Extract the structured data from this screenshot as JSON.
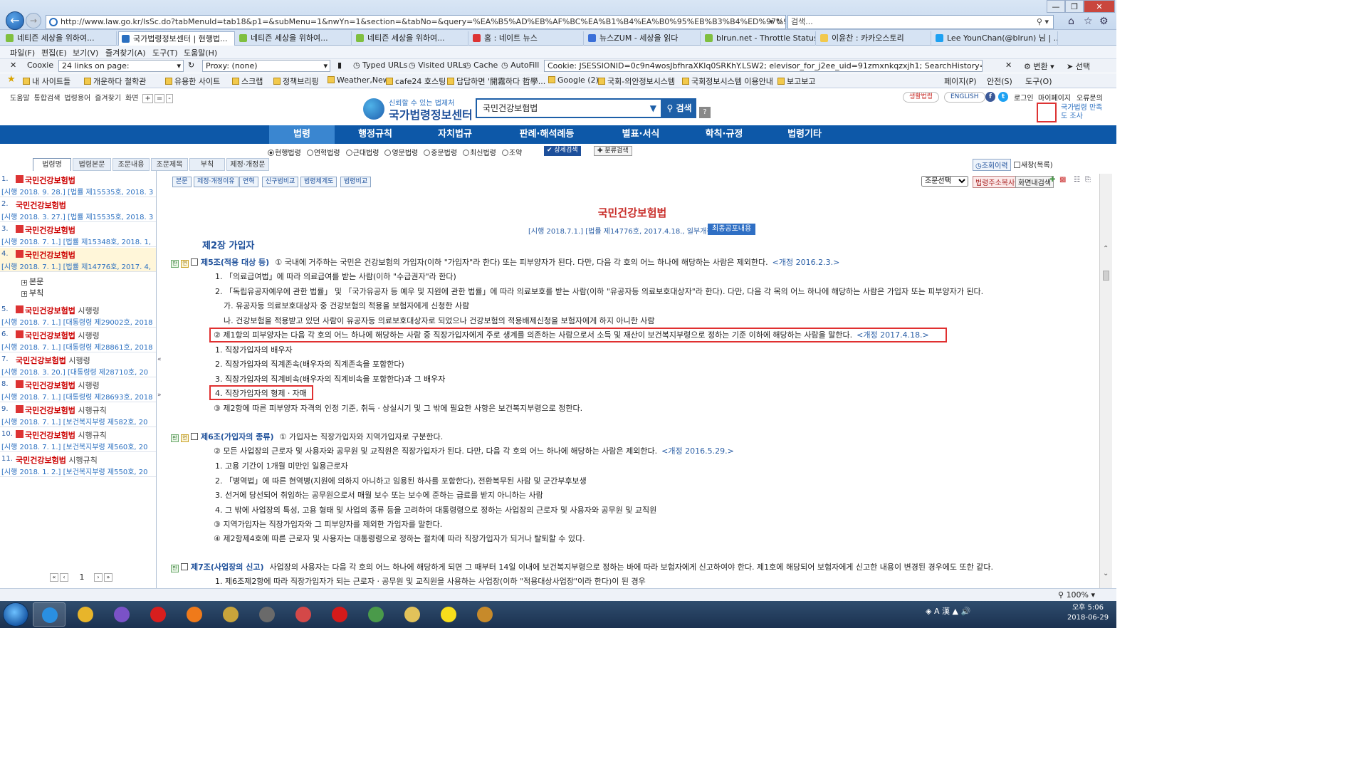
{
  "browser": {
    "url": "http://www.law.go.kr/lsSc.do?tabMenuId=tab18&p1=&subMenu=1&nwYn=1&section=&tabNo=&query=%EA%B5%AD%EB%AF%BC%EA%B1%B4%EA%B0%95%EB%B3%B4%ED%97%98%EB%B2%95#undefined",
    "search_placeholder": "검색...",
    "tabs": [
      {
        "label": "네티즌 세상을 위하여...",
        "color": "#7fbf3f"
      },
      {
        "label": "국가법령정보센터 | 현행법...",
        "color": "#2a6fc0"
      },
      {
        "label": "네티즌 세상을 위하여...",
        "color": "#7fbf3f"
      },
      {
        "label": "네티즌 세상을 위하여...",
        "color": "#7fbf3f"
      },
      {
        "label": "홈 : 네이트 뉴스",
        "color": "#d33"
      },
      {
        "label": "뉴스ZUM - 세상을 읽다",
        "color": "#3a6fd8"
      },
      {
        "label": "blrun.net - Throttle Status",
        "color": "#7fbf3f"
      },
      {
        "label": "이윤찬 : 카카오스토리",
        "color": "#f2c94c"
      },
      {
        "label": "Lee YounChan(@blrun) 님 | ...",
        "color": "#1da1f2"
      }
    ],
    "menu": [
      "파일(F)",
      "편집(E)",
      "보기(V)",
      "즐겨찾기(A)",
      "도구(T)",
      "도움말(H)"
    ],
    "toolbar": {
      "cooxie": "Cooxie",
      "links": "24 links on page:",
      "proxy": "Proxy: (none)",
      "typed_urls": "Typed URLs",
      "visited_urls": "Visited URLs",
      "cache": "Cache",
      "autofill": "AutoFill",
      "cookie": "Cookie: JSESSIONID=0c9n4wosJbfhraXKlq0SRKhY.LSW2; elevisor_for_j2ee_uid=91zmxnkqzxjh1; SearchHistory=%25uAD6D%25uBBFC%2",
      "convert": "변환",
      "select": "선택"
    },
    "favorites": [
      "내 사이트들",
      "개운하다 철학관",
      "유용한 사이트",
      "스크랩",
      "정책브리핑",
      "Weather,News",
      "cafe24 호스팅",
      "답답하면 '開霧하다 哲學...",
      "Google (2)",
      "국회-의안정보시스템",
      "국회정보시스템 이용안내",
      "보고보고"
    ],
    "fav_tools": [
      "페이지(P)",
      "안전(S)",
      "도구(O)"
    ],
    "zoom": "100%"
  },
  "site": {
    "util_links": [
      "도움말",
      "통합검색",
      "법령용어",
      "즐겨찾기",
      "화면",
      "+",
      "=",
      "-"
    ],
    "slogan": "신뢰할 수 있는 법제처",
    "name": "국가법령정보센터",
    "search_value": "국민건강보험법",
    "search_button": "검색",
    "help": "?",
    "pill_life": "생활법령",
    "pill_english": "ENGLISH",
    "right_links": [
      "로그인",
      "마이페이지",
      "오류문의"
    ],
    "survey": "국가법령 만족도 조사",
    "nav": [
      "법령",
      "행정규칙",
      "자치법규",
      "판례·해석례등",
      "별표·서식",
      "학칙·규정",
      "법령기타"
    ],
    "radios": [
      "현행법령",
      "연혁법령",
      "근대법령",
      "영문법령",
      "중문법령",
      "최신법령",
      "조약"
    ],
    "detail_search": "상세검색",
    "category_search": "분류검색",
    "left_tabs": [
      "법령명",
      "법령본문",
      "조문내용",
      "조문제목",
      "부칙",
      "제정·개정문"
    ],
    "history_btn": "조회이력",
    "new_window": "새창(목록)"
  },
  "left_list": [
    {
      "num": "1.",
      "badge": true,
      "name": "국민건강보험법",
      "suffix": "",
      "sub": "[시행 2018. 9. 28.] [법률 제15535호, 2018. 3"
    },
    {
      "num": "2.",
      "badge": false,
      "name": "국민건강보험법",
      "suffix": "",
      "sub": "[시행 2018. 3. 27.] [법률 제15535호, 2018. 3"
    },
    {
      "num": "3.",
      "badge": true,
      "name": "국민건강보험법",
      "suffix": "",
      "sub": "[시행 2018. 7. 1.] [법률 제15348호, 2018. 1,"
    },
    {
      "num": "4.",
      "badge": true,
      "name": "국민건강보험법",
      "suffix": "",
      "sub": "[시행 2018. 7. 1.] [법률 제14776호, 2017. 4,"
    },
    {
      "num": "5.",
      "badge": true,
      "name": "국민건강보험법",
      "suffix": " 시행령",
      "sub": "[시행 2018. 7. 1.] [대통령령 제29002호, 2018"
    },
    {
      "num": "6.",
      "badge": true,
      "name": "국민건강보험법",
      "suffix": " 시행령",
      "sub": "[시행 2018. 7. 1.] [대통령령 제28861호, 2018"
    },
    {
      "num": "7.",
      "badge": false,
      "name": "국민건강보험법",
      "suffix": " 시행령",
      "sub": "[시행 2018. 3. 20.] [대통령령 제28710호, 20"
    },
    {
      "num": "8.",
      "badge": true,
      "name": "국민건강보험법",
      "suffix": " 시행령",
      "sub": "[시행 2018. 7. 1.] [대통령령 제28693호, 2018"
    },
    {
      "num": "9.",
      "badge": true,
      "name": "국민건강보험법",
      "suffix": " 시행규칙",
      "sub": "[시행 2018. 7. 1.] [보건복지부령 제582호, 20"
    },
    {
      "num": "10.",
      "badge": true,
      "name": "국민건강보험법",
      "suffix": " 시행규칙",
      "sub": "[시행 2018. 7. 1.] [보건복지부령 제560호, 20"
    },
    {
      "num": "11.",
      "badge": false,
      "name": "국민건강보험법",
      "suffix": " 시행규칙",
      "sub": "[시행 2018. 1. 2.] [보건복지부령 제550호, 20"
    }
  ],
  "tree": [
    "본문",
    "부칙"
  ],
  "pager_page": "1",
  "content": {
    "buttons": [
      "본문",
      "제정·개정이유",
      "연혁",
      "신구법비교",
      "법령체계도",
      "법령비교"
    ],
    "select": "조문선택",
    "addr_btn": "법령주소복사",
    "screen_search": "화면내검색",
    "title": "국민건강보험법",
    "meta": "[시행 2018.7.1.] [법률 제14776호, 2017.4.18., 일부개정]",
    "meta_btn": "최종공포내용",
    "chapter": "제2장 가입자",
    "lines": [
      {
        "badges": [
          "판",
          "연"
        ],
        "check": true,
        "head": "제5조(적용 대상 등)",
        "text": "① 국내에 거주하는 국민은 건강보험의 가입자(이하 \"가입자\"라 한다) 또는 피부양자가 된다. 다만, 다음 각 호의 어느 하나에 해당하는 사람은 제외한다.",
        "amend": "<개정 2016.2.3.>"
      },
      {
        "text": "1. 「의료급여법」에 따라 의료급여를 받는 사람(이하 \"수급권자\"라 한다)"
      },
      {
        "text": "2. 「독립유공자예우에 관한 법률」 및 「국가유공자 등 예우 및 지원에 관한 법률」에 따라 의료보호를 받는 사람(이하 \"유공자등 의료보호대상자\"라 한다). 다만, 다음 각 목의 어느 하나에 해당하는 사람은 가입자 또는 피부양자가 된다."
      },
      {
        "text": "가. 유공자등 의료보호대상자 중 건강보험의 적용을 보험자에게 신청한 사람"
      },
      {
        "text": "나. 건강보험을 적용받고 있던 사람이 유공자등 의료보호대상자로 되었으나 건강보험의 적용배제신청을 보험자에게 하지 아니한 사람"
      },
      {
        "text": "② 제1항의 피부양자는 다음 각 호의 어느 하나에 해당하는 사람 중 직장가입자에게 주로 생계를 의존하는 사람으로서 소득 및 재산이 보건복지부령으로 정하는 기준 이하에 해당하는 사람을 말한다.",
        "amend": "<개정 2017.4.18.>"
      },
      {
        "text": "1. 직장가입자의 배우자"
      },
      {
        "text": "2. 직장가입자의 직계존속(배우자의 직계존속을 포함한다)"
      },
      {
        "text": "3. 직장가입자의 직계비속(배우자의 직계비속을 포함한다)과 그 배우자"
      },
      {
        "text": "4. 직장가입자의 형제ㆍ자매"
      },
      {
        "text": "③ 제2항에 따른 피부양자 자격의 인정 기준, 취득ㆍ상실시기 및 그 밖에 필요한 사항은 보건복지부령으로 정한다."
      },
      {
        "badges": [
          "판",
          "연"
        ],
        "check": true,
        "head": "제6조(가입자의 종류)",
        "text": "① 가입자는 직장가입자와 지역가입자로 구분한다."
      },
      {
        "text": "② 모든 사업장의 근로자 및 사용자와 공무원 및 교직원은 직장가입자가 된다. 다만, 다음 각 호의 어느 하나에 해당하는 사람은 제외한다.",
        "amend": "<개정 2016.5.29.>"
      },
      {
        "text": "1. 고용 기간이 1개월 미만인 일용근로자"
      },
      {
        "text": "2. 「병역법」에 따른 현역병(지원에 의하지 아니하고 임용된 하사를 포함한다), 전환복무된 사람 및 군간부후보생"
      },
      {
        "text": "3. 선거에 당선되어 취임하는 공무원으로서 매월 보수 또는 보수에 준하는 급료를 받지 아니하는 사람"
      },
      {
        "text": "4. 그 밖에 사업장의 특성, 고용 형태 및 사업의 종류 등을 고려하여 대통령령으로 정하는 사업장의 근로자 및 사용자와 공무원 및 교직원"
      },
      {
        "text": "③ 지역가입자는 직장가입자와 그 피부양자를 제외한 가입자를 말한다."
      },
      {
        "text": "④ 제2항제4호에 따른 근로자 및 사용자는 대통령령으로 정하는 절차에 따라 직장가입자가 되거나 탈퇴할 수 있다."
      },
      {
        "badges": [
          "판"
        ],
        "check": true,
        "head": "제7조(사업장의 신고)",
        "text": "사업장의 사용자는 다음 각 호의 어느 하나에 해당하게 되면 그 때부터 14일 이내에 보건복지부령으로 정하는 바에 따라 보험자에게 신고하여야 한다. 제1호에 해당되어 보험자에게 신고한 내용이 변경된 경우에도 또한 같다."
      },
      {
        "text": "1. 제6조제2항에 따라 직장가입자가 되는 근로자ㆍ공무원 및 교직원을 사용하는 사업장(이하 \"적용대상사업장\"이라 한다)이 된 경우"
      }
    ]
  },
  "taskbar": {
    "time": "오후 5:06",
    "date": "2018-06-29",
    "apps": [
      {
        "name": "internet-explorer",
        "color": "#2a8fe0"
      },
      {
        "name": "chrome",
        "color": "#e8b52a"
      },
      {
        "name": "app-s",
        "color": "#7a52c7"
      },
      {
        "name": "opera",
        "color": "#d81e1e"
      },
      {
        "name": "firefox",
        "color": "#f07a1a"
      },
      {
        "name": "app-pen",
        "color": "#c8a43b"
      },
      {
        "name": "app-box",
        "color": "#6a6a6a"
      },
      {
        "name": "app-ball",
        "color": "#d44848"
      },
      {
        "name": "app-record",
        "color": "#d41a1a"
      },
      {
        "name": "app-tree",
        "color": "#4a9a4a"
      },
      {
        "name": "explorer",
        "color": "#e2c25a"
      },
      {
        "name": "kakaotalk",
        "color": "#f7de1c"
      },
      {
        "name": "app-bird",
        "color": "#c78a2a"
      }
    ]
  }
}
